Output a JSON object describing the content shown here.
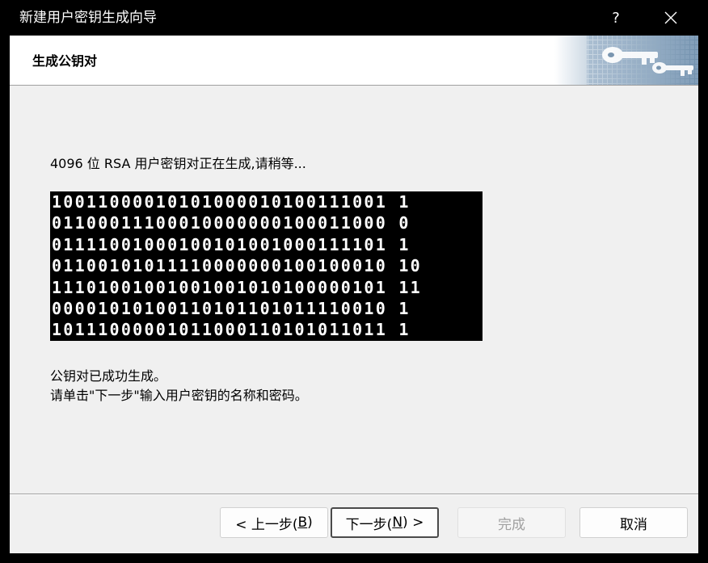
{
  "window": {
    "title": "新建用户密钥生成向导",
    "help_label": "?",
    "close_icon": "close-icon"
  },
  "header": {
    "title": "生成公钥对",
    "art_icon": "keys-icon"
  },
  "main": {
    "progress_text": "4096 位 RSA 用户密钥对正在生成,请稍等...",
    "binary_rows": [
      "10011000010101000010100111001 1",
      "01100011100010000000100011000 0",
      "01111001000100101001000111101 1",
      "01100101011110000000100100010 10",
      "11101001001001001010100000101 11",
      "00001010100110101101011110010 1",
      "10111000001011000110101011011 1"
    ],
    "complete_line1": "公钥对已成功生成。",
    "complete_line2": "请单击\"下一步\"输入用户密钥的名称和密码。"
  },
  "footer": {
    "back_prefix": "< 上一步(",
    "back_key": "B",
    "back_suffix": ")",
    "next_prefix": "下一步(",
    "next_key": "N",
    "next_suffix": ") >",
    "finish_label": "完成",
    "cancel_label": "取消"
  },
  "colors": {
    "dialog_bg": "#f0f0f0",
    "header_bg": "#ffffff",
    "binary_bg": "#000000",
    "binary_fg": "#ffffff",
    "disabled_text": "#a0a0a0"
  }
}
